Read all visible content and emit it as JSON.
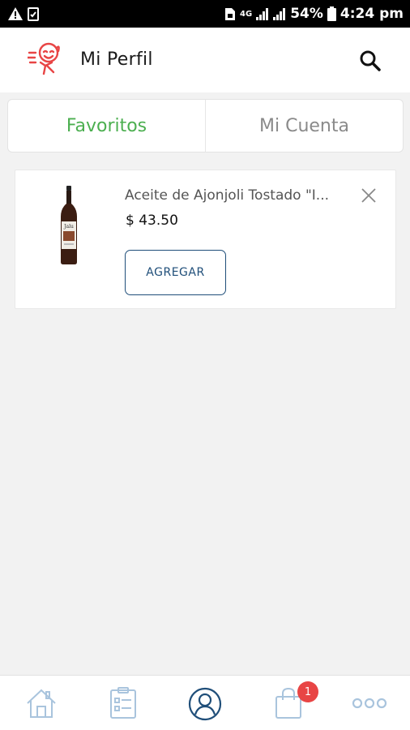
{
  "status_bar": {
    "battery": "54%",
    "time": "4:24 pm",
    "network": "4G"
  },
  "header": {
    "title": "Mi Perfil",
    "logo_icon": "runner-face-icon",
    "search_icon": "search-icon",
    "brand_color": "#e84545"
  },
  "tabs": [
    {
      "label": "Favoritos",
      "active": true
    },
    {
      "label": "Mi Cuenta",
      "active": false
    }
  ],
  "favorites": [
    {
      "name": "Aceite de Ajonjoli Tostado \"I...",
      "price": "$ 43.50",
      "add_label": "AGREGAR",
      "remove_icon": "close-icon"
    }
  ],
  "bottom_nav": {
    "items": [
      "home-icon",
      "orders-icon",
      "profile-icon",
      "cart-icon",
      "more-icon"
    ],
    "active": "profile-icon",
    "cart_badge": "1",
    "active_color": "#1f4e79",
    "inactive_color": "#a9c4dd",
    "badge_color": "#e84545"
  },
  "colors": {
    "active_tab": "#4caf50",
    "inactive_tab": "#8a8a8a",
    "background": "#f2f2f2"
  }
}
